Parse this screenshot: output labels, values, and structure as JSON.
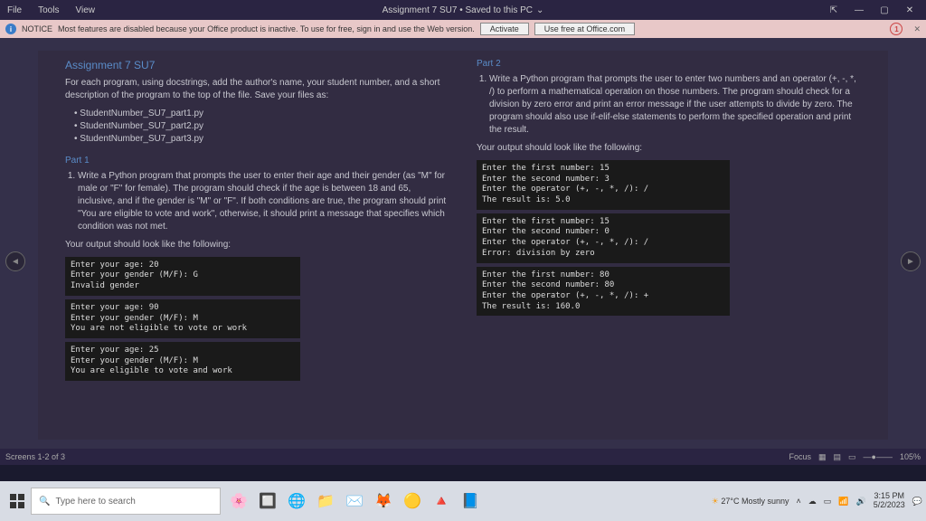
{
  "menu": {
    "file": "File",
    "tools": "Tools",
    "view": "View"
  },
  "title": "Assignment 7 SU7 • Saved to this PC",
  "notice": {
    "label": "NOTICE",
    "text": "Most features are disabled because your Office product is inactive. To use for free, sign in and use the Web version.",
    "activate": "Activate",
    "free": "Use free at Office.com",
    "badge": "1"
  },
  "doc": {
    "heading": "Assignment 7 SU7",
    "intro": "For each program, using docstrings, add the author's name, your student number, and a short description of the program to the top of the file. Save your files as:",
    "files": [
      "StudentNumber_SU7_part1.py",
      "StudentNumber_SU7_part2.py",
      "StudentNumber_SU7_part3.py"
    ],
    "part1": {
      "title": "Part 1",
      "item": "Write a Python program that prompts the user to enter their age and their gender (as \"M\" for male or \"F\" for female). The program should check if the age is between 18 and 65, inclusive, and if the gender is \"M\" or \"F\". If both conditions are true, the program should print \"You are eligible to vote and work\", otherwise, it should print a message that specifies which condition was not met.",
      "out": "Your output should look like the following:"
    },
    "t1": "Enter your age: 20\nEnter your gender (M/F): G\nInvalid gender",
    "t2": "Enter your age: 90\nEnter your gender (M/F): M\nYou are not eligible to vote or work",
    "t3": "Enter your age: 25\nEnter your gender (M/F): M\nYou are eligible to vote and work",
    "part2": {
      "title": "Part 2",
      "item": "Write a Python program that prompts the user to enter two numbers and an operator (+, -, *, /) to perform a mathematical operation on those numbers. The program should check for a division by zero error and print an error message if the user attempts to divide by zero. The program should also use if-elif-else statements to perform the specified operation and print the result.",
      "out": "Your output should look like the following:"
    },
    "t4": "Enter the first number: 15\nEnter the second number: 3\nEnter the operator (+, -, *, /): /\nThe result is: 5.0",
    "t5": "Enter the first number: 15\nEnter the second number: 0\nEnter the operator (+, -, *, /): /\nError: division by zero",
    "t6": "Enter the first number: 80\nEnter the second number: 80\nEnter the operator (+, -, *, /): +\nThe result is: 160.0"
  },
  "status": {
    "screens": "Screens 1-2 of 3",
    "focus": "Focus",
    "zoom": "105%"
  },
  "taskbar": {
    "search": "Type here to search",
    "weather": "27°C Mostly sunny",
    "time": "3:15 PM",
    "date": "5/2/2023"
  }
}
